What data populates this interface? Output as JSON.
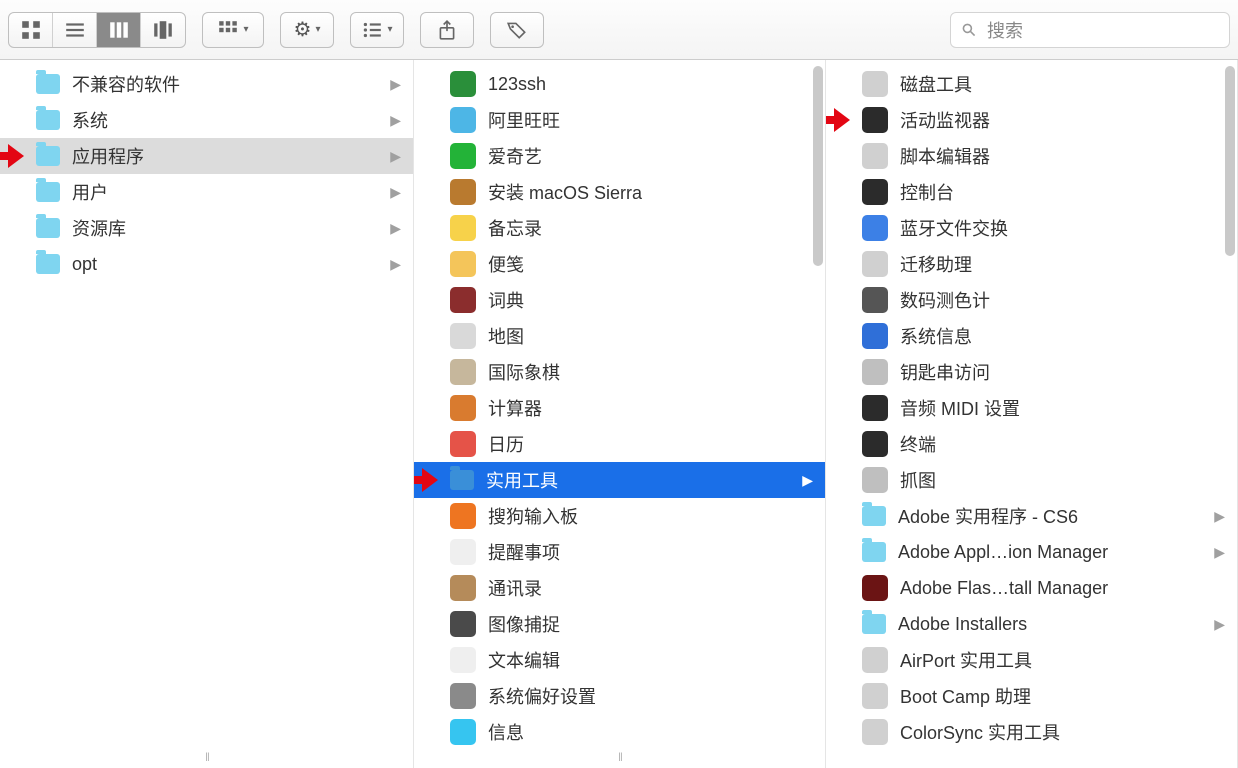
{
  "search": {
    "placeholder": "搜索"
  },
  "columns": [
    {
      "selected_index": 2,
      "selected_style": "grey",
      "items": [
        {
          "label": "不兼容的软件",
          "icon": "folder-cyan",
          "has_children": true
        },
        {
          "label": "系统",
          "icon": "folder-cyan",
          "has_children": true
        },
        {
          "label": "应用程序",
          "icon": "folder-cyan",
          "has_children": true,
          "arrow": true
        },
        {
          "label": "用户",
          "icon": "folder-cyan",
          "has_children": true
        },
        {
          "label": "资源库",
          "icon": "folder-cyan",
          "has_children": true
        },
        {
          "label": "opt",
          "icon": "folder-cyan",
          "has_children": true
        }
      ]
    },
    {
      "selected_index": 11,
      "selected_style": "blue",
      "items": [
        {
          "label": "123ssh",
          "icon": "app",
          "bg": "#2a8f3a"
        },
        {
          "label": "阿里旺旺",
          "icon": "app",
          "bg": "#4db6e6"
        },
        {
          "label": "爱奇艺",
          "icon": "app",
          "bg": "#23b338"
        },
        {
          "label": "安装 macOS Sierra",
          "icon": "app",
          "bg": "#b97a2f"
        },
        {
          "label": "备忘录",
          "icon": "app",
          "bg": "#f7d24a"
        },
        {
          "label": "便笺",
          "icon": "app",
          "bg": "#f4c55a"
        },
        {
          "label": "词典",
          "icon": "app",
          "bg": "#8b2d2d"
        },
        {
          "label": "地图",
          "icon": "app",
          "bg": "#d9d9d9"
        },
        {
          "label": "国际象棋",
          "icon": "app",
          "bg": "#c6b79c"
        },
        {
          "label": "计算器",
          "icon": "app",
          "bg": "#d97b2f"
        },
        {
          "label": "日历",
          "icon": "app",
          "bg": "#e55348"
        },
        {
          "label": "实用工具",
          "icon": "folder-dark",
          "has_children": true,
          "arrow": true
        },
        {
          "label": "搜狗输入板",
          "icon": "app",
          "bg": "#ee7521"
        },
        {
          "label": "提醒事项",
          "icon": "app",
          "bg": "#efefef"
        },
        {
          "label": "通讯录",
          "icon": "app",
          "bg": "#b58b5a"
        },
        {
          "label": "图像捕捉",
          "icon": "app",
          "bg": "#4a4a4a"
        },
        {
          "label": "文本编辑",
          "icon": "app",
          "bg": "#efefef"
        },
        {
          "label": "系统偏好设置",
          "icon": "app",
          "bg": "#8a8a8a"
        },
        {
          "label": "信息",
          "icon": "app",
          "bg": "#36c5f0"
        }
      ]
    },
    {
      "items": [
        {
          "label": "磁盘工具",
          "icon": "app",
          "bg": "#d0d0d0"
        },
        {
          "label": "活动监视器",
          "icon": "app",
          "bg": "#2b2b2b",
          "arrow": true
        },
        {
          "label": "脚本编辑器",
          "icon": "app",
          "bg": "#d0d0d0"
        },
        {
          "label": "控制台",
          "icon": "app",
          "bg": "#2b2b2b"
        },
        {
          "label": "蓝牙文件交换",
          "icon": "app",
          "bg": "#3c80e6"
        },
        {
          "label": "迁移助理",
          "icon": "app",
          "bg": "#d0d0d0"
        },
        {
          "label": "数码测色计",
          "icon": "app",
          "bg": "#555"
        },
        {
          "label": "系统信息",
          "icon": "app",
          "bg": "#2f6fd8"
        },
        {
          "label": "钥匙串访问",
          "icon": "app",
          "bg": "#bfbfbf"
        },
        {
          "label": "音频 MIDI 设置",
          "icon": "app",
          "bg": "#2b2b2b"
        },
        {
          "label": "终端",
          "icon": "app",
          "bg": "#2b2b2b"
        },
        {
          "label": "抓图",
          "icon": "app",
          "bg": "#bfbfbf"
        },
        {
          "label": "Adobe 实用程序 - CS6",
          "icon": "folder-cyan",
          "has_children": true
        },
        {
          "label": "Adobe Appl…ion Manager",
          "icon": "folder-cyan",
          "has_children": true
        },
        {
          "label": "Adobe Flas…tall Manager",
          "icon": "app",
          "bg": "#6b1414"
        },
        {
          "label": "Adobe Installers",
          "icon": "folder-cyan",
          "has_children": true
        },
        {
          "label": "AirPort 实用工具",
          "icon": "app",
          "bg": "#d0d0d0"
        },
        {
          "label": "Boot Camp 助理",
          "icon": "app",
          "bg": "#d0d0d0"
        },
        {
          "label": "ColorSync 实用工具",
          "icon": "app",
          "bg": "#d0d0d0"
        }
      ]
    }
  ],
  "annotations": {
    "arrow_count": 3
  }
}
